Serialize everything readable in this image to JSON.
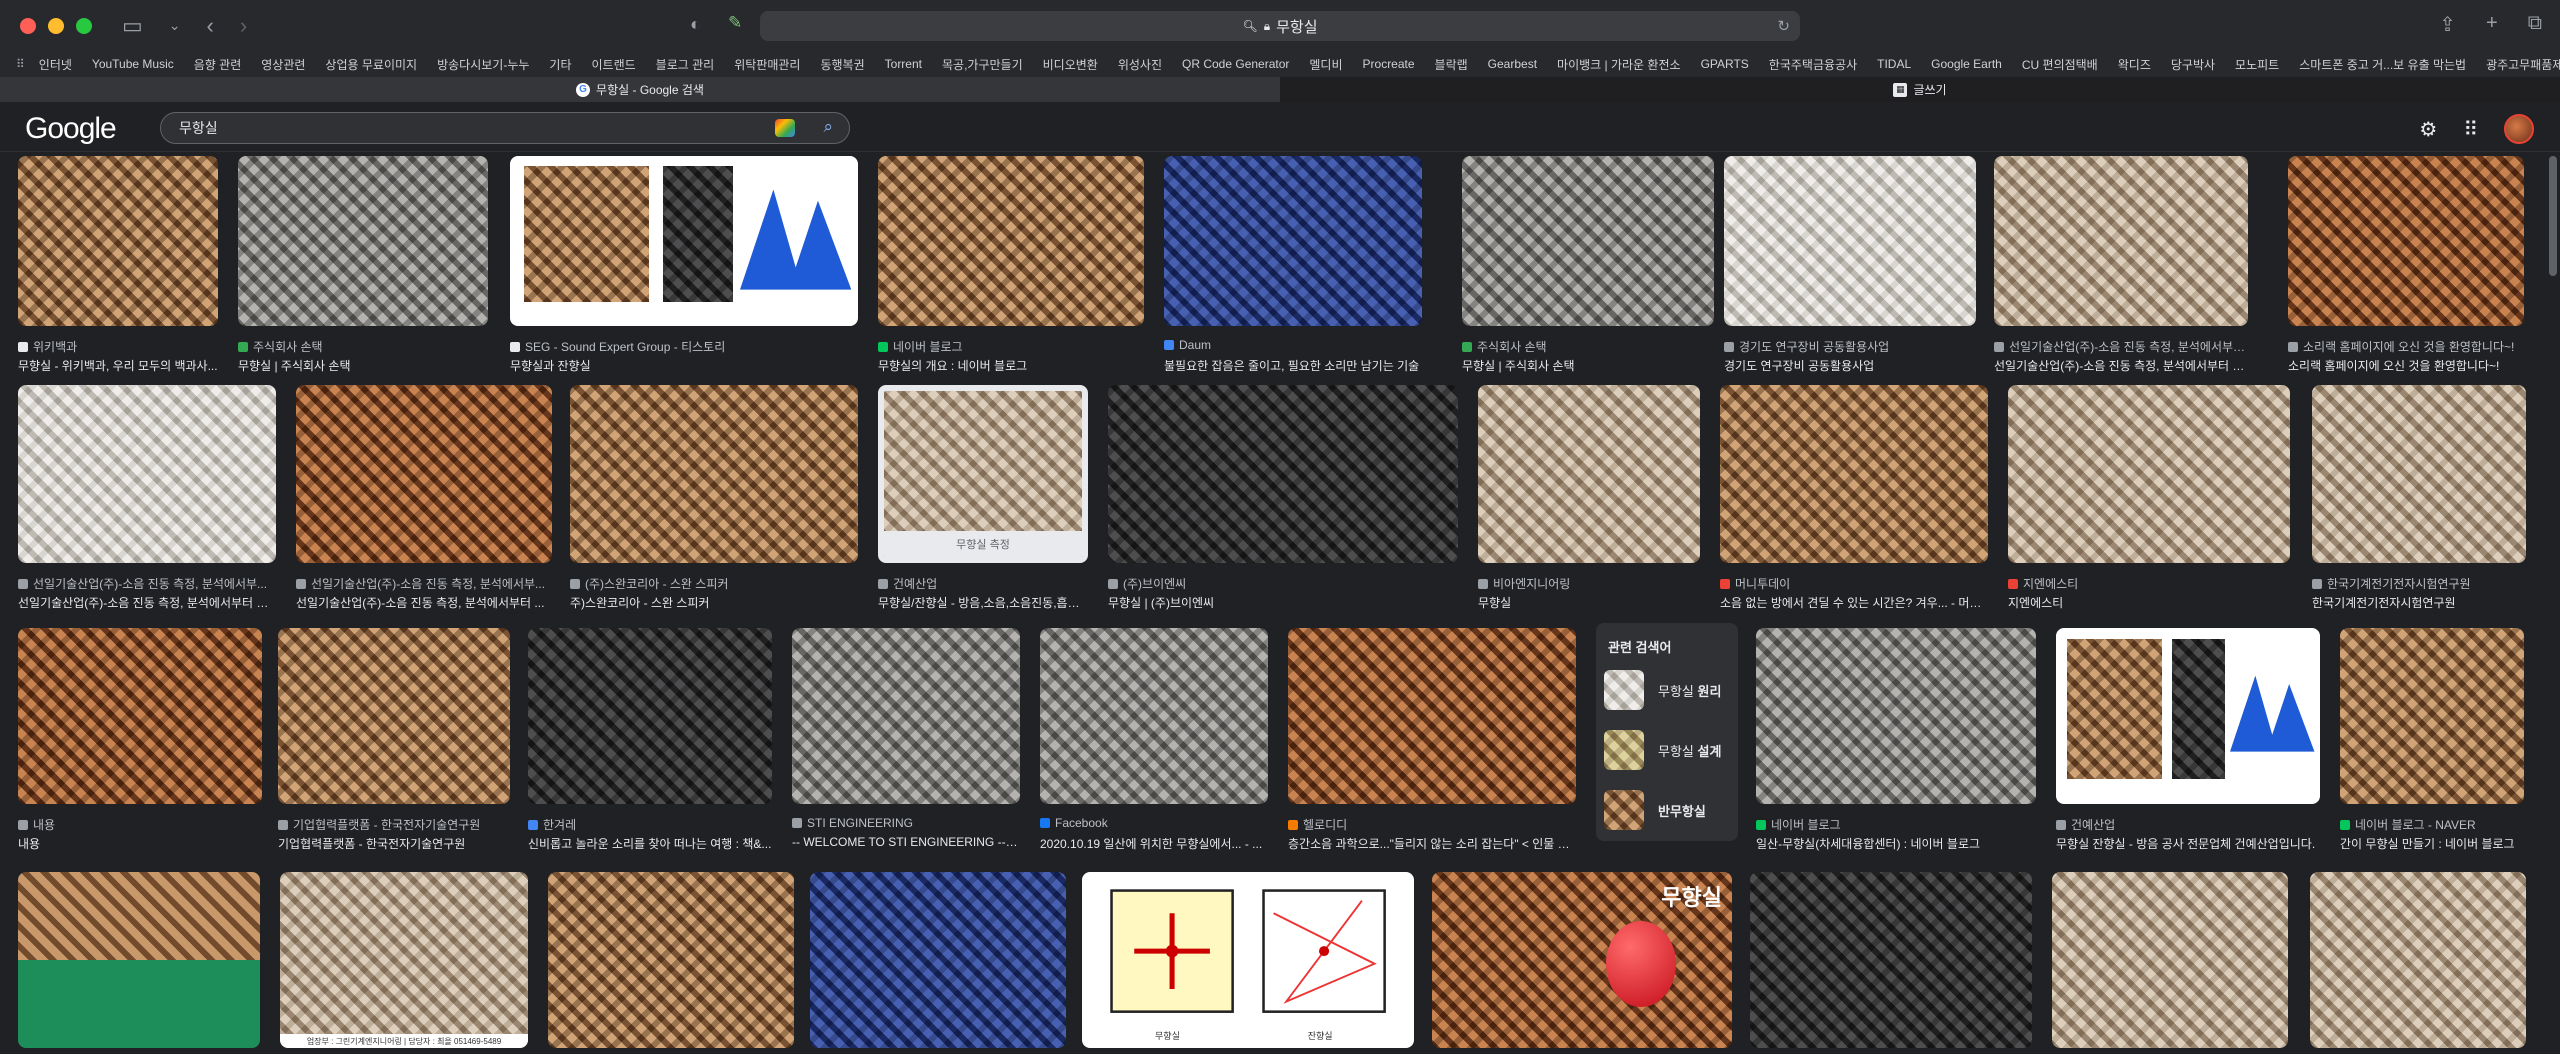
{
  "browser": {
    "address": "무항실",
    "bookmarks": [
      "인터넷",
      "YouTube Music",
      "음향 관련",
      "영상관련",
      "상업용 무료이미지",
      "방송다시보기-누누",
      "기타",
      "이트랜드",
      "블로그 관리",
      "위탁판매관리",
      "동행복권",
      "Torrent",
      "목공,가구만들기",
      "비디오변환",
      "위성사진",
      "QR Code Generator",
      "멜디비",
      "Procreate",
      "블락랩",
      "Gearbest",
      "마이뱅크 | 가라운 환전소",
      "GPARTS",
      "한국주택금융공사",
      "TIDAL",
      "Google Earth",
      "CU 편의점택배",
      "왁디즈",
      "당구박사",
      "모노피트",
      "스마트폰 중고 거...보 유출 막는법",
      "광주고무패품제조... 실리콘고무팜"
    ],
    "tabs": [
      {
        "label": "무항실 - Google 검색",
        "active": true
      },
      {
        "label": "글쓰기",
        "active": false
      }
    ]
  },
  "google": {
    "logo": "Google",
    "query": "무항실"
  },
  "results": [
    {
      "src": "위키백과",
      "title": "무향실 - 위키백과, 우리 모두의 백과사...",
      "icolor": "#e8eaed"
    },
    {
      "src": "주식회사 손택",
      "title": "무향실 | 주식회사 손택",
      "icolor": "#34a853"
    },
    {
      "src": "SEG - Sound Expert Group - 티스토리",
      "title": "무향실과 잔향실",
      "icolor": "#e8eaed"
    },
    {
      "src": "네이버 블로그",
      "title": "무향실의 개요 : 네이버 블로그",
      "icolor": "#03c75a"
    },
    {
      "src": "Daum",
      "title": "불필요한 잡음은 줄이고, 필요한 소리만 남기는 기술",
      "icolor": "#4285f4"
    },
    {
      "src": "주식회사 손택",
      "title": "무향실 | 주식회사 손택",
      "icolor": "#34a853"
    },
    {
      "src": "경기도 연구장비 공동활용사업",
      "title": "경기도 연구장비 공동활용사업",
      "icolor": "#9aa0a6"
    },
    {
      "src": "선일기술산업(주)-소음 진동 측정, 분석에서부터 대...",
      "title": "선일기술산업(주)-소음 진동 측정, 분석에서부터 대책...",
      "icolor": "#9aa0a6"
    },
    {
      "src": "소리랙 홈페이지에 오신 것을 환영합니다~!",
      "title": "소리랙 홈페이지에 오신 것을 환영합니다~!",
      "icolor": "#9aa0a6"
    },
    {
      "src": "선일기술산업(주)-소음 진동 측정, 분석에서부...",
      "title": "선일기술산업(주)-소음 진동 측정, 분석에서부터 대...",
      "icolor": "#9aa0a6"
    },
    {
      "src": "선일기술산업(주)-소음 진동 측정, 분석에서부...",
      "title": "선일기술산업(주)-소음 진동 측정, 분석에서부터 ...",
      "icolor": "#9aa0a6"
    },
    {
      "src": "(주)스완코리아 - 스완 스피커",
      "title": "주)스완코리아 - 스완 스피커",
      "icolor": "#9aa0a6"
    },
    {
      "src": "건예산업",
      "title": "무향실/잔향실 - 방음,소음,소음진동,흡음...",
      "icolor": "#9aa0a6",
      "caption": "무향실 측정"
    },
    {
      "src": "(주)브이엔씨",
      "title": "무향실 | (주)브이엔씨",
      "icolor": "#9aa0a6"
    },
    {
      "src": "비아엔지니어링",
      "title": "무향실",
      "icolor": "#9aa0a6"
    },
    {
      "src": "머니투데이",
      "title": "소음 없는 방에서 견딜 수 있는 시간은? 겨우... - 머니...",
      "icolor": "#ea4335"
    },
    {
      "src": "지엔에스티",
      "title": "지엔에스티",
      "icolor": "#ea4335"
    },
    {
      "src": "한국기계전기전자시험연구원",
      "title": "한국기계전기전자시험연구원",
      "icolor": "#9aa0a6"
    },
    {
      "src": "내용",
      "title": "내용",
      "icolor": "#9aa0a6"
    },
    {
      "src": "기업협력플랫폼 - 한국전자기술연구원",
      "title": "기업협력플랫폼 - 한국전자기술연구원",
      "icolor": "#9aa0a6"
    },
    {
      "src": "한겨레",
      "title": "신비롭고 놀라운 소리를 찾아 떠나는 여행 : 책&...",
      "icolor": "#4285f4"
    },
    {
      "src": "STI ENGINEERING",
      "title": "-- WELCOME TO STI ENGINEERING --- ...",
      "icolor": "#9aa0a6"
    },
    {
      "src": "Facebook",
      "title": "2020.10.19 일산에 위치한 무향실에서... - ...",
      "icolor": "#1877f2"
    },
    {
      "src": "헬로디디",
      "title": "층간소음 과학으로...\"들리지 않는 소리 잡는다\" < 인물 < ...",
      "icolor": "#f57c00"
    },
    {
      "src": "네이버 블로그",
      "title": "일산-무향실(차세대융합센터) : 네이버 블로그",
      "icolor": "#03c75a"
    },
    {
      "src": "건예산업",
      "title": "무향실 잔향실 - 방음 공사 전문업체 건예산업입니다.",
      "icolor": "#9aa0a6"
    },
    {
      "src": "네이버 블로그 - NAVER",
      "title": "간이 무향실 만들기 : 네이버 블로그",
      "icolor": "#03c75a"
    }
  ],
  "row4": [
    {
      "overlay": ""
    },
    {
      "overlay": "",
      "caption": "업장부 : 그린기계엔지니어링 | 담당자 : 최을 051469-5489"
    },
    {
      "overlay": ""
    },
    {
      "overlay": ""
    },
    {
      "overlay": "",
      "labels": [
        "무향실",
        "잔향실"
      ]
    },
    {
      "overlay": "무향실"
    },
    {
      "overlay": ""
    },
    {
      "overlay": ""
    },
    {
      "overlay": ""
    }
  ],
  "related": {
    "heading": "관련 검색어",
    "items": [
      {
        "prefix": "무항실 ",
        "bold": "원리"
      },
      {
        "prefix": "무항실 ",
        "bold": "설계"
      },
      {
        "prefix": "",
        "bold": "반무항실"
      }
    ]
  }
}
